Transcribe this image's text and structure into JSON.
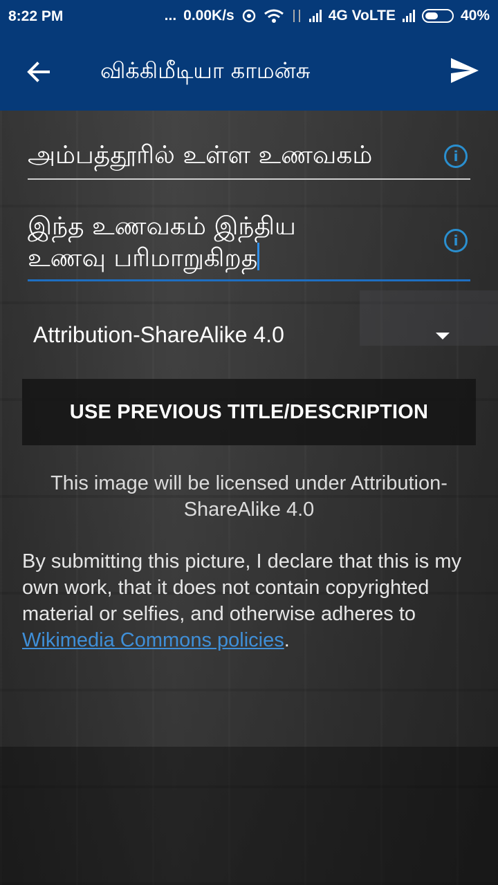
{
  "status_bar": {
    "time": "8:22 PM",
    "dots": "...",
    "speed": "0.00K/s",
    "network": "4G VoLTE",
    "battery": "40%"
  },
  "toolbar": {
    "title": "விக்கிமீடியா காமன்சு",
    "back_icon": "arrow-back-icon",
    "send_icon": "send-icon"
  },
  "form": {
    "title_value": "அம்பத்தூரில் உள்ள உணவகம்",
    "description_line1": "இந்த உணவகம் இந்திய",
    "description_line2": "உணவு பரிமாறுகிறத",
    "license_selected": "Attribution-ShareAlike 4.0",
    "use_previous_button": "USE PREVIOUS TITLE/DESCRIPTION",
    "license_note": "This image will be licensed under Attribution-ShareAlike 4.0",
    "declaration_text": "By submitting this picture, I declare that this is my own work, that it does not contain copyrighted material or selfies, and otherwise adheres to ",
    "policy_link": "Wikimedia Commons policies",
    "declaration_end": "."
  },
  "colors": {
    "primary": "#063a79",
    "accent": "#1e6fc2",
    "link": "#3f8fd8"
  }
}
